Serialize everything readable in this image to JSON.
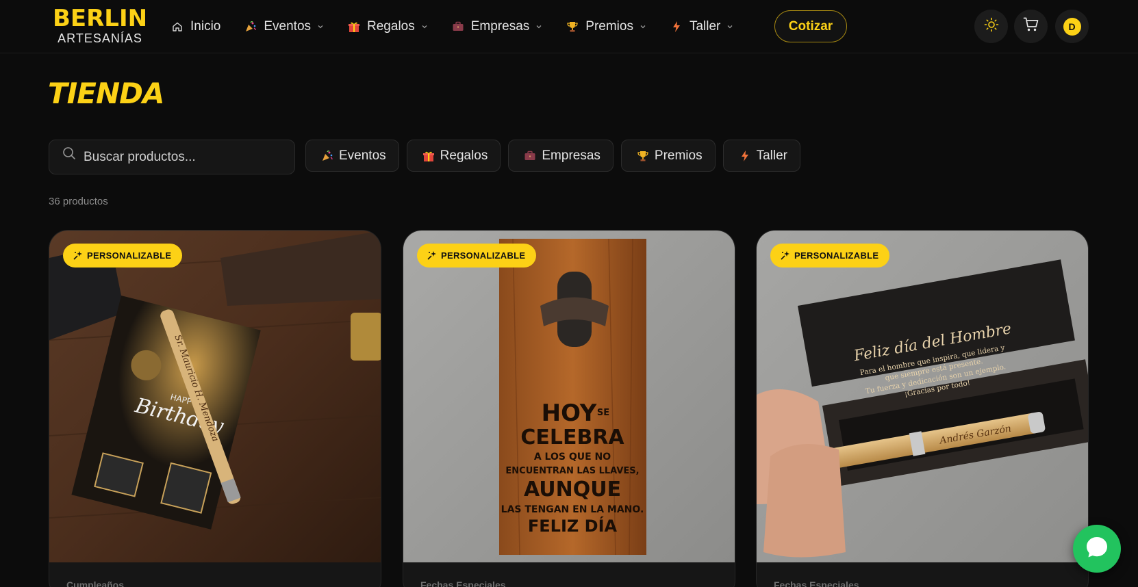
{
  "brand": {
    "name": "BERLIN",
    "tagline": "ARTESANÍAS"
  },
  "nav": {
    "items": [
      {
        "label": "Inicio",
        "icon": "home-icon",
        "dropdown": false
      },
      {
        "label": "Eventos",
        "icon": "party-popper-icon",
        "dropdown": true
      },
      {
        "label": "Regalos",
        "icon": "gift-icon",
        "dropdown": true
      },
      {
        "label": "Empresas",
        "icon": "briefcase-icon",
        "dropdown": true
      },
      {
        "label": "Premios",
        "icon": "trophy-icon",
        "dropdown": true
      },
      {
        "label": "Taller",
        "icon": "lightning-icon",
        "dropdown": true
      }
    ],
    "quote_label": "Cotizar"
  },
  "header_actions": {
    "theme_icon": "sun-icon",
    "cart_icon": "cart-icon",
    "avatar_initial": "D"
  },
  "page": {
    "title": "TIENDA"
  },
  "search": {
    "placeholder": "Buscar productos...",
    "value": ""
  },
  "filters": [
    {
      "label": "Eventos",
      "icon": "party-popper-icon"
    },
    {
      "label": "Regalos",
      "icon": "gift-icon"
    },
    {
      "label": "Empresas",
      "icon": "briefcase-icon"
    },
    {
      "label": "Premios",
      "icon": "trophy-icon"
    },
    {
      "label": "Taller",
      "icon": "lightning-icon"
    }
  ],
  "results": {
    "count_label": "36 productos"
  },
  "products": [
    {
      "badge": "PERSONALIZABLE",
      "category": "Cumpleaños",
      "image_text": {
        "line1": "HAPPY",
        "line2": "Birthday",
        "engraving": "Sr. Mauricio H. Mendoza"
      }
    },
    {
      "badge": "PERSONALIZABLE",
      "category": "Fechas Especiales",
      "image_text": {
        "line1": "HOY",
        "line1b": "SE",
        "line2": "CELEBRA",
        "line3": "A LOS QUE NO",
        "line4": "ENCUENTRAN LAS LLAVES,",
        "line5": "AUNQUE",
        "line6": "LAS TENGAN EN LA MANO.",
        "line7": "FELIZ DÍA"
      }
    },
    {
      "badge": "PERSONALIZABLE",
      "category": "Fechas Especiales",
      "image_text": {
        "title": "Feliz día del Hombre",
        "line1": "Para el hombre que inspira, que lidera y",
        "line2": "que siempre está presente.",
        "line3": "Tu fuerza y dedicación son un ejemplo.",
        "line4": "¡Gracias por todo!",
        "engraving": "Andrés Garzón"
      }
    }
  ],
  "colors": {
    "accent": "#fcd116",
    "background": "#0c0c0c",
    "whatsapp": "#22c35e"
  },
  "floating": {
    "whatsapp_icon": "whatsapp-chat-icon"
  }
}
